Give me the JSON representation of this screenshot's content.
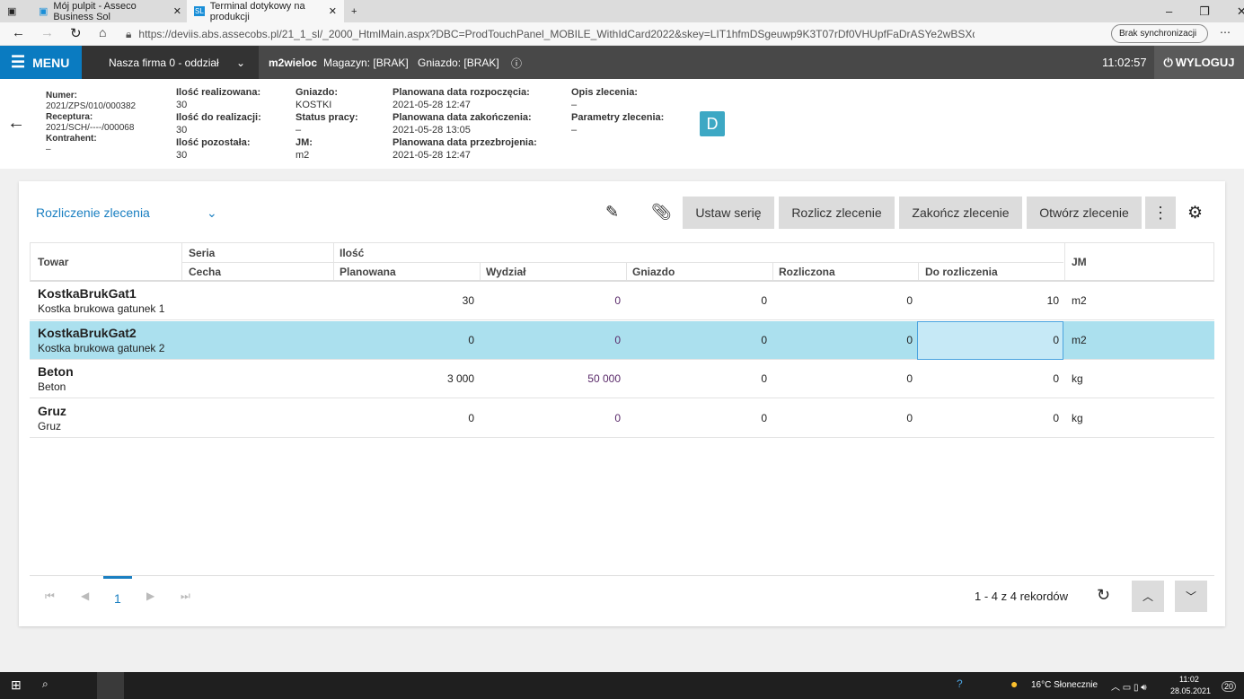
{
  "browser": {
    "tabs": [
      {
        "label": "Mój pulpit - Asseco Business Sol"
      },
      {
        "label": "Terminal dotykowy na produkcji"
      }
    ],
    "url": "https://deviis.abs.assecobs.pl/21_1_sl/_2000_HtmlMain.aspx?DBC=ProdTouchPanel_MOBILE_WithIdCard2022&skey=LIT1hfmDSgeuwp9K3T07rDf0VHUpfFaDrASYe2wBSXqn2ciToq...",
    "sync": "Brak synchronizacji"
  },
  "appbar": {
    "menu": "MENU",
    "firm": "Nasza firma 0 - oddział",
    "user": "m2wieloc",
    "warehouse": "Magazyn: [BRAK]",
    "socket": "Gniazdo: [BRAK]",
    "time": "11:02:57",
    "logout": "WYLOGUJ"
  },
  "info": {
    "numer_l": "Numer:",
    "numer": "2021/ZPS/010/000382",
    "receptura_l": "Receptura:",
    "receptura": "2021/SCH/----/000068",
    "kontrahent_l": "Kontrahent:",
    "kontrahent": "–",
    "ilr_l": "Ilość realizowana:",
    "ilr": "30",
    "ildr_l": "Ilość do realizacji:",
    "ildr": "30",
    "ilp_l": "Ilość pozostała:",
    "ilp": "30",
    "gn_l": "Gniazdo:",
    "gn": "KOSTKI",
    "st_l": "Status pracy:",
    "st": "–",
    "jm_l": "JM:",
    "jm": "m2",
    "pdr_l": "Planowana data rozpoczęcia:",
    "pdr": "2021-05-28 12:47",
    "pdz_l": "Planowana data zakończenia:",
    "pdz": "2021-05-28 13:05",
    "pdp_l": "Planowana data przezbrojenia:",
    "pdp": "2021-05-28 12:47",
    "opis_l": "Opis zlecenia:",
    "opis": "–",
    "param_l": "Parametry zlecenia:",
    "param": "–",
    "badge": "D"
  },
  "toolbar": {
    "view": "Rozliczenie zlecenia",
    "b1": "Ustaw serię",
    "b2": "Rozlicz zlecenie",
    "b3": "Zakończ zlecenie",
    "b4": "Otwórz zlecenie"
  },
  "table": {
    "headers": {
      "towar": "Towar",
      "seria": "Seria",
      "cecha": "Cecha",
      "ilosc": "Ilość",
      "plan": "Planowana",
      "wydzial": "Wydział",
      "gniazdo": "Gniazdo",
      "rozl": "Rozliczona",
      "dorozl": "Do rozliczenia",
      "jm": "JM"
    },
    "rows": [
      {
        "code": "KostkaBrukGat1",
        "name": "Kostka brukowa gatunek 1",
        "plan": "30",
        "wydzial": "0",
        "gniazdo": "0",
        "rozl": "0",
        "dorozl": "10",
        "jm": "m2"
      },
      {
        "code": "KostkaBrukGat2",
        "name": "Kostka brukowa gatunek 2",
        "plan": "0",
        "wydzial": "0",
        "gniazdo": "0",
        "rozl": "0",
        "dorozl": "0",
        "jm": "m2"
      },
      {
        "code": "Beton",
        "name": "Beton",
        "plan": "3 000",
        "wydzial": "50 000",
        "gniazdo": "0",
        "rozl": "0",
        "dorozl": "0",
        "jm": "kg"
      },
      {
        "code": "Gruz",
        "name": "Gruz",
        "plan": "0",
        "wydzial": "0",
        "gniazdo": "0",
        "rozl": "0",
        "dorozl": "0",
        "jm": "kg"
      }
    ]
  },
  "pager": {
    "page": "1",
    "summary": "1 - 4 z 4 rekordów"
  },
  "taskbar": {
    "weather": "16°C  Słonecznie",
    "time": "11:02",
    "date": "28.05.2021",
    "notif": "20"
  }
}
